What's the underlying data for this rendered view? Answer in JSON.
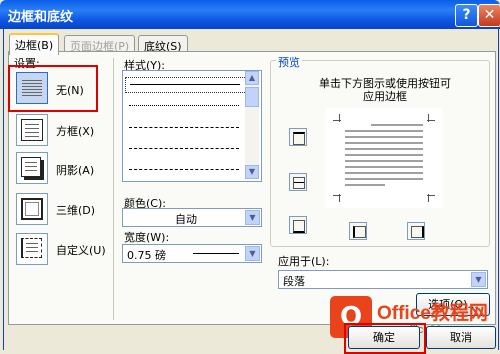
{
  "dialog": {
    "title": "边框和底纹"
  },
  "title_buttons": {
    "help": "?",
    "close": "✕"
  },
  "tabs": [
    {
      "label": "边框(B)",
      "active": true,
      "enabled": true
    },
    {
      "label": "页面边框(P)",
      "active": false,
      "enabled": false
    },
    {
      "label": "底纹(S)",
      "active": false,
      "enabled": true
    }
  ],
  "settings": {
    "label": "设置:",
    "items": [
      {
        "label": "无(N)",
        "icon": "border-none-icon",
        "selected": true
      },
      {
        "label": "方框(X)",
        "icon": "border-box-icon",
        "selected": false
      },
      {
        "label": "阴影(A)",
        "icon": "border-shadow-icon",
        "selected": false
      },
      {
        "label": "三维(D)",
        "icon": "border-3d-icon",
        "selected": false
      },
      {
        "label": "自定义(U)",
        "icon": "border-custom-icon",
        "selected": false
      }
    ]
  },
  "style": {
    "label": "样式(Y):"
  },
  "color": {
    "label": "颜色(C):",
    "value": "自动"
  },
  "width": {
    "label": "宽度(W):",
    "value": "0.75 磅"
  },
  "preview": {
    "label": "预览",
    "hint_line1": "单击下方图示或使用按钮可",
    "hint_line2": "应用边框"
  },
  "apply_to": {
    "label": "应用于(L):",
    "value": "段落"
  },
  "buttons": {
    "options": "选项(O)...",
    "ok": "确定",
    "cancel": "取消"
  },
  "watermark": {
    "line1": "Office教程网",
    "line2": "www.office26.com"
  },
  "colors": {
    "titlebar": "#0a5ee8",
    "dialog_bg": "#ece9d8",
    "highlight": "#e00000",
    "watermark": "#e8431a"
  }
}
